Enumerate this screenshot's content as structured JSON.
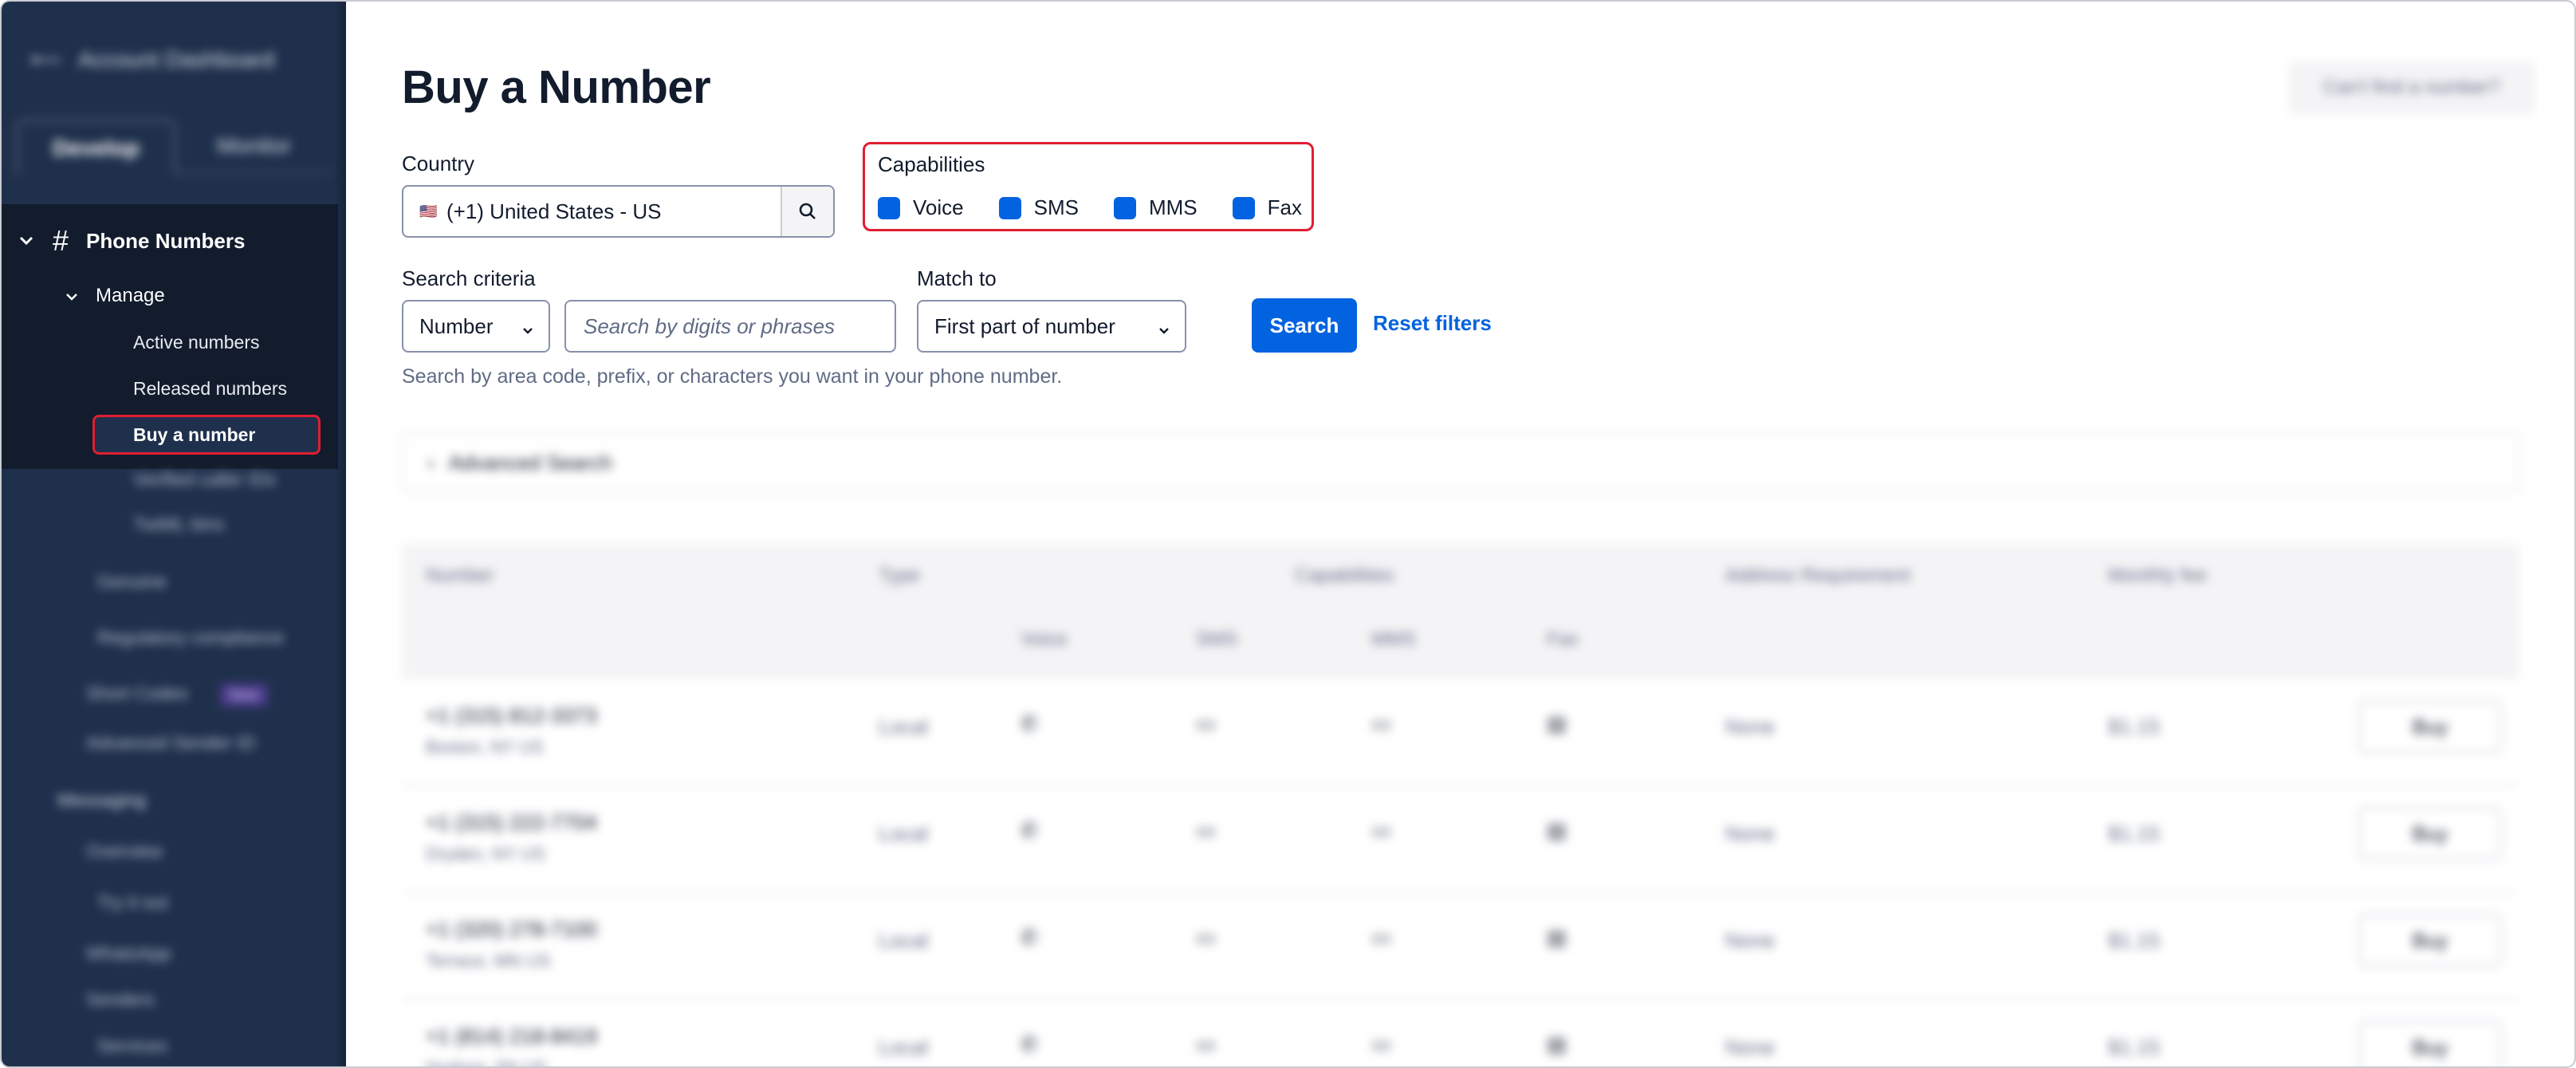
{
  "sidebar": {
    "account_label": "Account Dashboard",
    "tabs": [
      "Develop",
      "Monitor"
    ],
    "section": "Phone Numbers",
    "manage_label": "Manage",
    "links": [
      "Active numbers",
      "Released numbers"
    ],
    "buy_label": "Buy a number",
    "lower_links": [
      "Verified caller IDs",
      "TwiML bins",
      "Genuine",
      "Regulatory compliance",
      "Short Codes",
      "Advanced Sender ID",
      "Messaging",
      "Overview",
      "Try it out",
      "WhatsApp",
      "Senders",
      "Services"
    ],
    "new_badge": "New"
  },
  "header": {
    "title": "Buy a Number",
    "help_button": "Can't find a number?"
  },
  "filters": {
    "country_label": "Country",
    "country_flag": "🇺🇸",
    "country_value": "(+1) United States - US",
    "capabilities_label": "Capabilities",
    "capabilities": [
      "Voice",
      "SMS",
      "MMS",
      "Fax"
    ],
    "search_criteria_label": "Search criteria",
    "search_criteria_value": "Number",
    "search_placeholder": "Search by digits or phrases",
    "match_to_label": "Match to",
    "match_to_value": "First part of number",
    "search_button": "Search",
    "reset_link": "Reset filters",
    "help_text": "Search by area code, prefix, or characters you want in your phone number."
  },
  "advanced": {
    "label": "Advanced Search"
  },
  "table": {
    "headers": {
      "number": "Number",
      "type": "Type",
      "capabilities": "Capabilities",
      "address": "Address Requirement",
      "fee": "Monthly fee"
    },
    "sub_headers": [
      "Voice",
      "SMS",
      "MMS",
      "Fax"
    ],
    "rows": [
      {
        "number": "+1 (315) 812-3373",
        "location": "Boston, NY US",
        "type": "Local",
        "address": "None",
        "fee": "$1.15",
        "action": "Buy"
      },
      {
        "number": "+1 (315) 222-7704",
        "location": "Dryden, NY US",
        "type": "Local",
        "address": "None",
        "fee": "$1.15",
        "action": "Buy"
      },
      {
        "number": "+1 (320) 278-7100",
        "location": "Terrace, MN US",
        "type": "Local",
        "address": "None",
        "fee": "$1.15",
        "action": "Buy"
      },
      {
        "number": "+1 (814) 218-8419",
        "location": "Hudson, PA US",
        "type": "Local",
        "address": "None",
        "fee": "$1.15",
        "action": "Buy"
      }
    ]
  },
  "colors": {
    "primary": "#0263e0",
    "highlight": "#e01e33",
    "sidebar": "#1f304c",
    "sidebar_dark": "#121c2d"
  }
}
